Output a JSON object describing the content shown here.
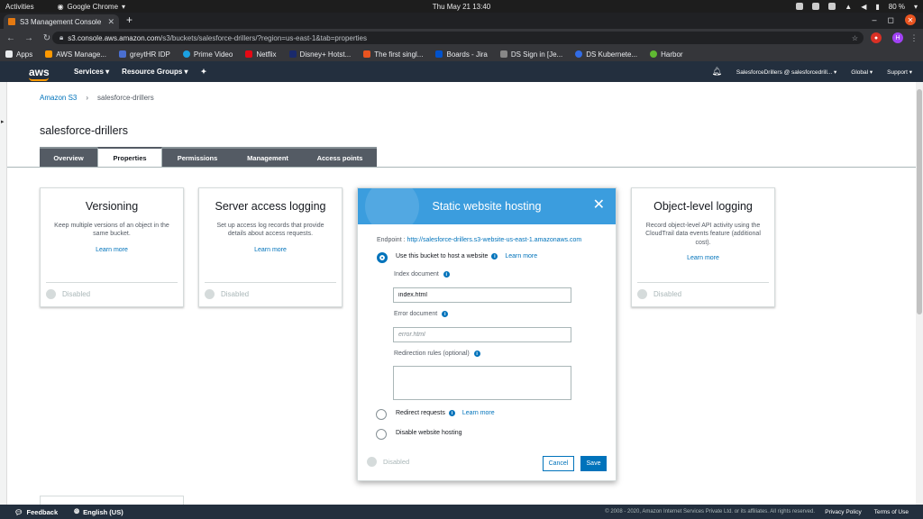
{
  "os": {
    "activities": "Activities",
    "app_name": "Google Chrome",
    "clock": "Thu May 21  13:40",
    "battery": "80 %"
  },
  "browser": {
    "tab_title": "S3 Management Console",
    "url_host": "s3.console.aws.amazon.com",
    "url_path": "/s3/buckets/salesforce-drillers/?region=us-east-1&tab=properties",
    "profile_initial": "H"
  },
  "bookmarks": [
    {
      "label": "Apps",
      "color": "#e8eaed"
    },
    {
      "label": "AWS Manage...",
      "color": "#ff9900"
    },
    {
      "label": "greytHR IDP",
      "color": "#4a6fd1"
    },
    {
      "label": "Prime Video",
      "color": "#1ba1e2"
    },
    {
      "label": "Netflix",
      "color": "#e50914"
    },
    {
      "label": "Disney+ Hotst...",
      "color": "#1a2a6c"
    },
    {
      "label": "The first singl...",
      "color": "#e95420"
    },
    {
      "label": "Boards - Jira",
      "color": "#0052cc"
    },
    {
      "label": "DS Sign in [Je...",
      "color": "#888888"
    },
    {
      "label": "DS Kubernete...",
      "color": "#326ce5"
    },
    {
      "label": "Harbor",
      "color": "#60b932"
    }
  ],
  "aws_nav": {
    "logo": "aws",
    "services": "Services",
    "resource_groups": "Resource Groups",
    "account": "SalesforceDrillers @ salesforcedrill...",
    "region": "Global",
    "support": "Support"
  },
  "breadcrumb": {
    "root": "Amazon S3",
    "separator": "›",
    "current": "salesforce-drillers"
  },
  "bucket_title": "salesforce-drillers",
  "tabs": [
    "Overview",
    "Properties",
    "Permissions",
    "Management",
    "Access points"
  ],
  "cards": {
    "versioning": {
      "title": "Versioning",
      "description": "Keep multiple versions of an object in the same bucket.",
      "learn_more": "Learn more",
      "status": "Disabled"
    },
    "server_access_logging": {
      "title": "Server access logging",
      "description": "Set up access log records that provide details about access requests.",
      "learn_more": "Learn more",
      "status": "Disabled"
    },
    "object_level_logging": {
      "title": "Object-level logging",
      "description": "Record object-level API activity using the CloudTrail data events feature (additional cost).",
      "learn_more": "Learn more",
      "status": "Disabled"
    }
  },
  "static_hosting": {
    "title": "Static website hosting",
    "endpoint_label": "Endpoint :",
    "endpoint_url": "http://salesforce-drillers.s3-website-us-east-1.amazonaws.com",
    "option_host": "Use this bucket to host a website",
    "option_redirect": "Redirect requests",
    "option_disable": "Disable website hosting",
    "learn_more": "Learn more",
    "index_label": "Index document",
    "index_value": "index.html",
    "error_label": "Error document",
    "error_placeholder": "error.html",
    "redirection_label": "Redirection rules (optional)",
    "status": "Disabled",
    "cancel": "Cancel",
    "save": "Save"
  },
  "footer": {
    "feedback": "Feedback",
    "language": "English (US)",
    "copyright": "© 2008 - 2020, Amazon Internet Services Private Ltd. or its affiliates. All rights reserved.",
    "privacy": "Privacy Policy",
    "terms": "Terms of Use"
  }
}
